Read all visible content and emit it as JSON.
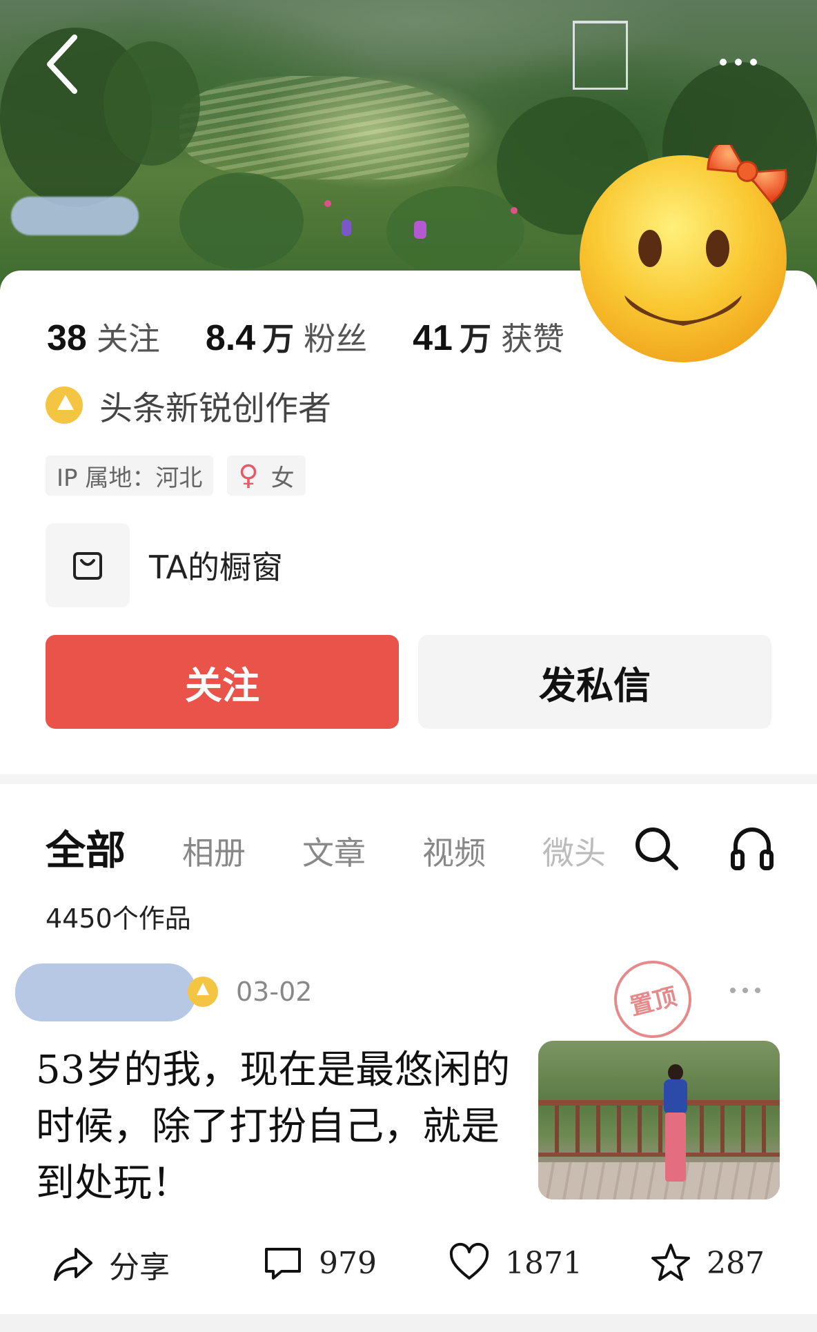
{
  "header": {
    "back_icon": "chevron-left-icon",
    "more_icon": "more-dots-icon"
  },
  "stats": [
    {
      "num": "38",
      "unit": "",
      "label": "关注"
    },
    {
      "num": "8.4",
      "unit": "万",
      "label": "粉丝"
    },
    {
      "num": "41",
      "unit": "万",
      "label": "获赞"
    }
  ],
  "badge": {
    "label": "头条新锐创作者"
  },
  "tags": {
    "ip": "IP 属地：河北",
    "gender_symbol": "♀",
    "gender": "女"
  },
  "shop": {
    "label": "TA的橱窗",
    "icon": "shopping-bag-icon"
  },
  "buttons": {
    "follow": "关注",
    "message": "发私信"
  },
  "tabs": [
    {
      "label": "全部",
      "active": true
    },
    {
      "label": "相册"
    },
    {
      "label": "文章"
    },
    {
      "label": "视频"
    },
    {
      "label": "微头"
    }
  ],
  "works_count": "4450个作品",
  "post": {
    "date": "03-02",
    "pin_label": "置顶",
    "text": "53岁的我，现在是最悠闲的时候，除了打扮自己，就是到处玩！",
    "share_label": "分享",
    "comments": "979",
    "likes": "1871",
    "favorites": "287"
  },
  "colors": {
    "follow_button": "#e9534a",
    "badge_gold": "#f4c542",
    "female": "#e9586a"
  }
}
